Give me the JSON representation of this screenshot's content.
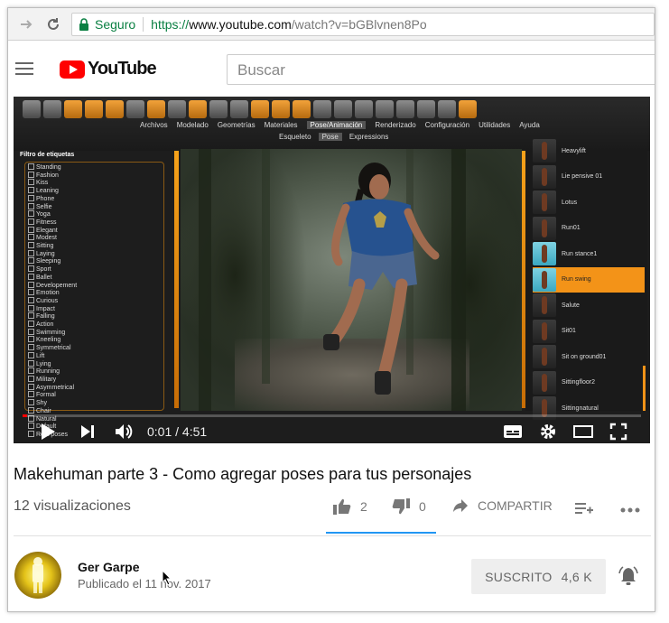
{
  "browser": {
    "secure_label": "Seguro",
    "url_scheme": "https://",
    "url_host": "www.youtube.com",
    "url_path": "/watch?v=bGBlvnen8Po"
  },
  "youtube": {
    "logo_text": "YouTube",
    "search_placeholder": "Buscar"
  },
  "video_frame": {
    "toolbar_tabs": [
      "Archivos",
      "Modelado",
      "Geometrías",
      "Materiales",
      "Pose/Animación",
      "Renderizado",
      "Configuración",
      "Utilidades",
      "Ayuda"
    ],
    "active_tab": "Pose/Animación",
    "sub_tabs": [
      "Esqueleto",
      "Pose",
      "Expressions"
    ],
    "active_sub_tab": "Pose",
    "tag_filter_title": "Filtro de etiquetas",
    "tags": [
      "Standing",
      "Fashion",
      "Kiss",
      "Leaning",
      "Phone",
      "Selfie",
      "Yoga",
      "Fitness",
      "Elegant",
      "Modest",
      "Sitting",
      "Laying",
      "Sleeping",
      "Sport",
      "Ballet",
      "Developement",
      "Emotion",
      "Curious",
      "Impact",
      "Falling",
      "Action",
      "Swimming",
      "Kneeling",
      "Symmetrical",
      "Lift",
      "Lying",
      "Running",
      "Military",
      "Asymmetrical",
      "Formal",
      "Shy",
      "Chair",
      "Natural",
      "Default",
      "Rest poses"
    ],
    "poses": [
      {
        "label": "Heavylift",
        "active": false,
        "lit": false
      },
      {
        "label": "Lie pensive 01",
        "active": false,
        "lit": false
      },
      {
        "label": "Lotus",
        "active": false,
        "lit": false
      },
      {
        "label": "Run01",
        "active": false,
        "lit": false
      },
      {
        "label": "Run stance1",
        "active": false,
        "lit": true
      },
      {
        "label": "Run swing",
        "active": true,
        "lit": true
      },
      {
        "label": "Salute",
        "active": false,
        "lit": false
      },
      {
        "label": "Sit01",
        "active": false,
        "lit": false
      },
      {
        "label": "Sit on ground01",
        "active": false,
        "lit": false
      },
      {
        "label": "Sittingfloor2",
        "active": false,
        "lit": false
      },
      {
        "label": "Sittingnatural",
        "active": false,
        "lit": false
      }
    ]
  },
  "player": {
    "time_display": "0:01 / 4:51",
    "progress_fraction": 0.004
  },
  "video": {
    "title": "Makehuman parte 3 - Como agregar poses para tus personajes",
    "views": "12 visualizaciones",
    "likes": "2",
    "dislikes": "0",
    "share_label": "COMPARTIR"
  },
  "channel": {
    "name": "Ger Garpe",
    "published": "Publicado el 11 nov. 2017",
    "subscribe_label": "SUSCRITO",
    "subscriber_count": "4,6 K"
  },
  "colors": {
    "youtube_red": "#ff0000",
    "makehuman_orange": "#f39318",
    "like_underline": "#2196f3",
    "secure_green": "#0b8043"
  }
}
